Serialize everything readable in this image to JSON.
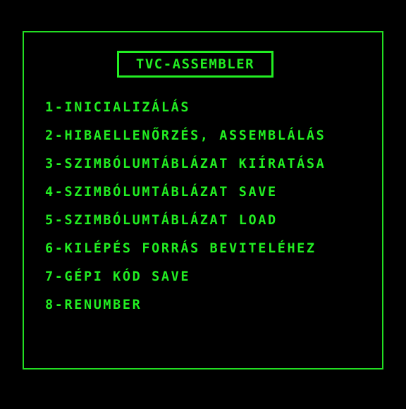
{
  "title": "TVC-ASSEMBLER",
  "colors": {
    "background": "#000000",
    "foreground": "#22ee22"
  },
  "menu": {
    "items": [
      {
        "label": "1-INICIALIZÁLÁS"
      },
      {
        "label": "2-HIBAELLENŐRZÉS, ASSEMBLÁLÁS"
      },
      {
        "label": "3-SZIMBÓLUMTÁBLÁZAT KIÍRATÁSA"
      },
      {
        "label": "4-SZIMBÓLUMTÁBLÁZAT SAVE"
      },
      {
        "label": "5-SZIMBÓLUMTÁBLÁZAT LOAD"
      },
      {
        "label": "6-KILÉPÉS FORRÁS BEVITELÉHEZ"
      },
      {
        "label": "7-GÉPI KÓD SAVE"
      },
      {
        "label": "8-RENUMBER"
      }
    ]
  }
}
